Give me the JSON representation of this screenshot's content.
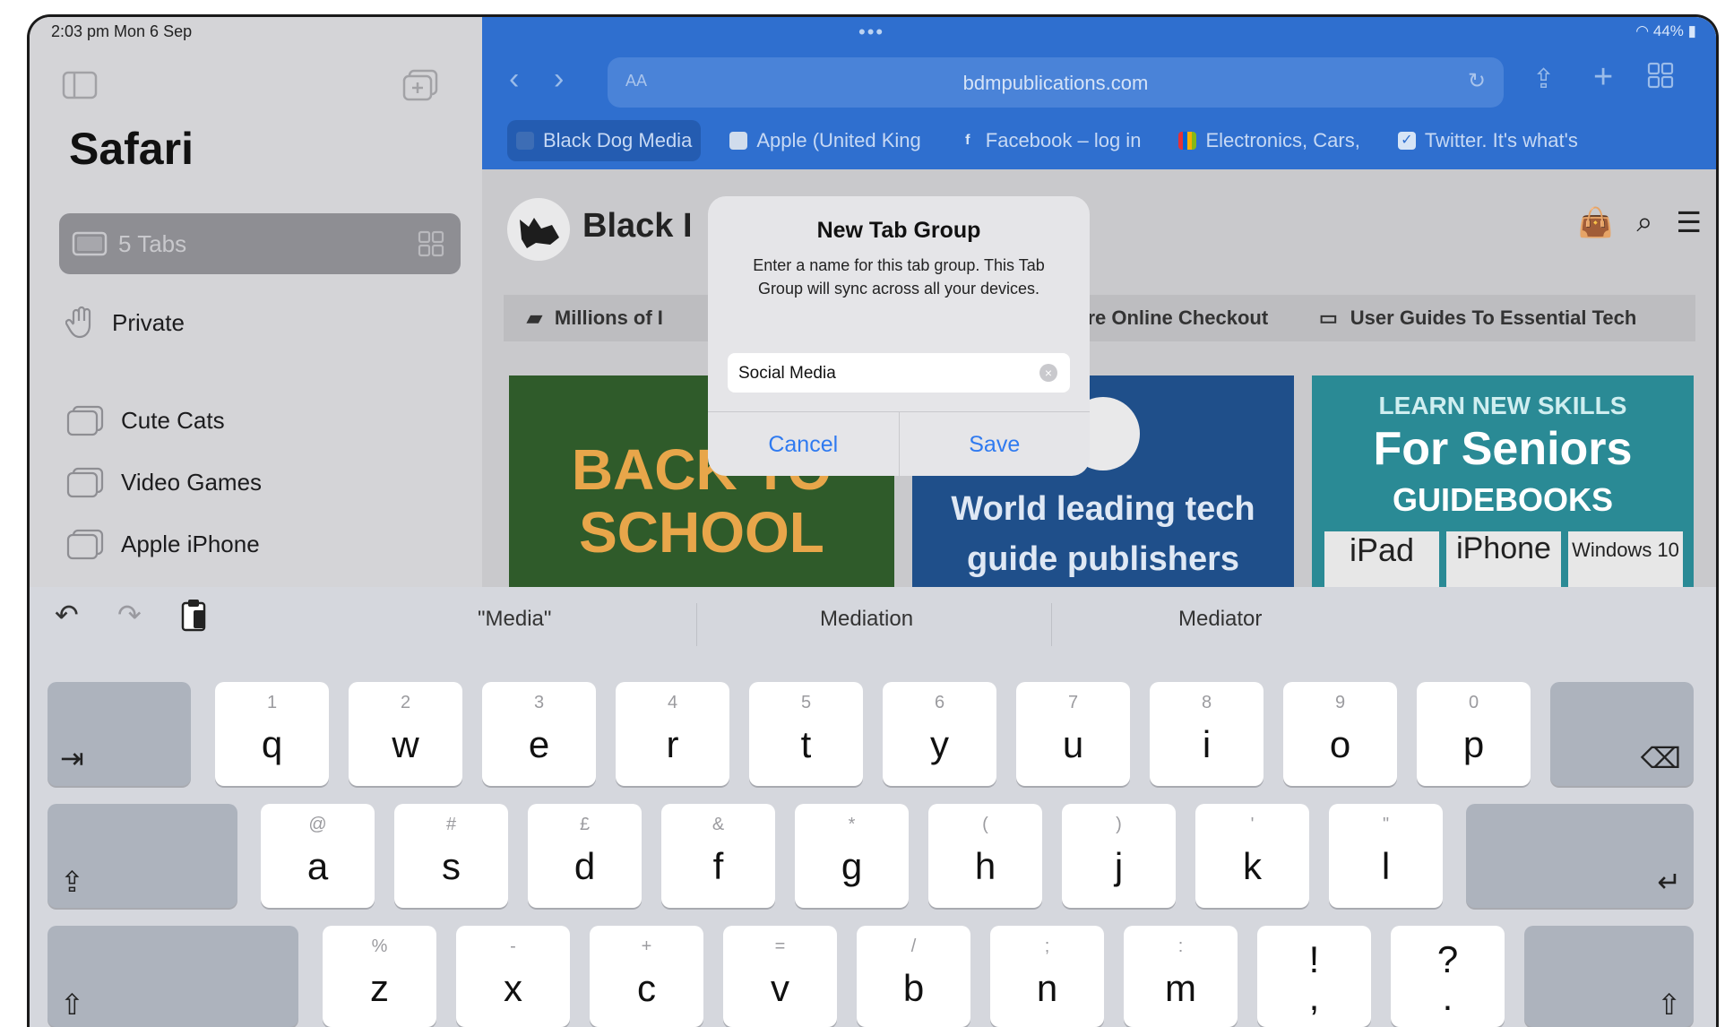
{
  "status": {
    "time_date": "2:03 pm  Mon 6 Sep",
    "battery": "44%"
  },
  "sidebar": {
    "title": "Safari",
    "tabs_label": "5 Tabs",
    "private_label": "Private",
    "groups": [
      {
        "label": "Cute Cats"
      },
      {
        "label": "Video Games"
      },
      {
        "label": "Apple iPhone"
      }
    ]
  },
  "browser": {
    "address_aa": "AA",
    "url": "bdmpublications.com",
    "tabs": [
      {
        "label": "Black Dog Media"
      },
      {
        "label": "Apple (United King"
      },
      {
        "label": "Facebook – log in"
      },
      {
        "label": "Electronics, Cars,"
      },
      {
        "label": "Twitter. It's what's"
      }
    ]
  },
  "page": {
    "site_name": "Black I",
    "info_left": "Millions of I",
    "info_mid": "ure Online Checkout",
    "info_right": "User Guides To Essential Tech",
    "promo1": "BACK TO SCHOOL",
    "promo2_l1": "World leading tech",
    "promo2_l2": "guide publishers",
    "promo3_l1": "LEARN NEW SKILLS",
    "promo3_l2": "For Seniors",
    "promo3_l3": "GUIDEBOOKS",
    "promo3_b1": "iPad",
    "promo3_b2": "iPhone",
    "promo3_b3": "Windows 10"
  },
  "dialog": {
    "title": "New Tab Group",
    "message": "Enter a name for this tab group. This Tab Group will sync across all your devices.",
    "input_value": "Social Media",
    "cancel": "Cancel",
    "save": "Save"
  },
  "keyboard": {
    "suggestions": [
      "\"Media\"",
      "Mediation",
      "Mediator"
    ],
    "row1": [
      {
        "alt": "1",
        "key": "q"
      },
      {
        "alt": "2",
        "key": "w"
      },
      {
        "alt": "3",
        "key": "e"
      },
      {
        "alt": "4",
        "key": "r"
      },
      {
        "alt": "5",
        "key": "t"
      },
      {
        "alt": "6",
        "key": "y"
      },
      {
        "alt": "7",
        "key": "u"
      },
      {
        "alt": "8",
        "key": "i"
      },
      {
        "alt": "9",
        "key": "o"
      },
      {
        "alt": "0",
        "key": "p"
      }
    ],
    "row2": [
      {
        "alt": "@",
        "key": "a"
      },
      {
        "alt": "#",
        "key": "s"
      },
      {
        "alt": "£",
        "key": "d"
      },
      {
        "alt": "&",
        "key": "f"
      },
      {
        "alt": "*",
        "key": "g"
      },
      {
        "alt": "(",
        "key": "h"
      },
      {
        "alt": ")",
        "key": "j"
      },
      {
        "alt": "'",
        "key": "k"
      },
      {
        "alt": "\"",
        "key": "l"
      }
    ],
    "row3": [
      {
        "alt": "%",
        "key": "z"
      },
      {
        "alt": "-",
        "key": "x"
      },
      {
        "alt": "+",
        "key": "c"
      },
      {
        "alt": "=",
        "key": "v"
      },
      {
        "alt": "/",
        "key": "b"
      },
      {
        "alt": ";",
        "key": "n"
      },
      {
        "alt": ":",
        "key": "m"
      },
      {
        "alt": "!",
        "key": ","
      },
      {
        "alt": "?",
        "key": "."
      }
    ]
  },
  "colors": {
    "accent": "#2f7af0",
    "toolbar": "#2f6fcf",
    "key_bg": "#ffffff",
    "fn_key_bg": "#adb3bd"
  }
}
